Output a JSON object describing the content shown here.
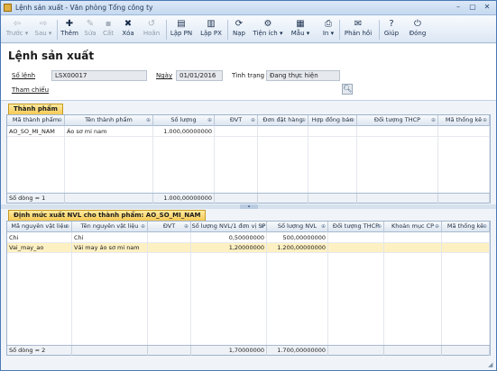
{
  "window": {
    "title": "Lệnh sản xuất - Văn phòng Tổng công ty",
    "controls": [
      "–",
      "▢",
      "✕"
    ]
  },
  "toolbar": [
    {
      "label": "Trước",
      "glyph": "⇦",
      "icon": "back-arrow-icon",
      "enabled": false,
      "dropdown": true
    },
    {
      "label": "Sau",
      "glyph": "⇨",
      "icon": "forward-arrow-icon",
      "enabled": false,
      "dropdown": true
    },
    {
      "label": "Thêm",
      "glyph": "✚",
      "icon": "add-icon",
      "enabled": true
    },
    {
      "label": "Sửa",
      "glyph": "✎",
      "icon": "edit-icon",
      "enabled": false
    },
    {
      "label": "Cất",
      "glyph": "▪",
      "icon": "save-icon",
      "enabled": false
    },
    {
      "label": "Xóa",
      "glyph": "✖",
      "icon": "delete-icon",
      "enabled": true
    },
    {
      "label": "Hoãn",
      "glyph": "↺",
      "icon": "undo-icon",
      "enabled": false
    },
    {
      "label": "Lập PN",
      "glyph": "▤",
      "icon": "receipt-icon",
      "enabled": true
    },
    {
      "label": "Lập PX",
      "glyph": "▥",
      "icon": "issue-icon",
      "enabled": true
    },
    {
      "label": "Nạp",
      "glyph": "⟳",
      "icon": "refresh-icon",
      "enabled": true
    },
    {
      "label": "Tiện ích",
      "glyph": "⚙",
      "icon": "utility-icon",
      "enabled": true,
      "dropdown": true
    },
    {
      "label": "Mẫu",
      "glyph": "▦",
      "icon": "template-icon",
      "enabled": true,
      "dropdown": true
    },
    {
      "label": "In",
      "glyph": "⎙",
      "icon": "print-icon",
      "enabled": true,
      "dropdown": true
    },
    {
      "label": "Phản hồi",
      "glyph": "✉",
      "icon": "feedback-icon",
      "enabled": true
    },
    {
      "label": "Giúp",
      "glyph": "?",
      "icon": "help-icon",
      "enabled": true
    },
    {
      "label": "Đóng",
      "glyph": "⏻",
      "icon": "close-icon",
      "enabled": true
    }
  ],
  "form": {
    "title": "Lệnh sản xuất",
    "so_lenh_label": "Số lệnh",
    "so_lenh": "LSX00017",
    "ngay_label": "Ngày",
    "ngay": "01/01/2016",
    "tinh_trang_label": "Tình trạng",
    "tinh_trang": "Đang thực hiện",
    "tham_chieu_label": "Tham chiếu"
  },
  "products": {
    "tab": "Thành phẩm",
    "columns": [
      "Mã thành phẩm",
      "Tên thành phẩm",
      "Số lượng",
      "ĐVT",
      "Đơn đặt hàng",
      "Hợp đồng bán",
      "Đối tượng THCP",
      "Mã thống kê"
    ],
    "rows": [
      [
        "AO_SO_MI_NAM",
        "Áo sơ mi nam",
        "1.000,00000000",
        "",
        "",
        "",
        "",
        ""
      ]
    ],
    "footer_count": "Số dòng = 1",
    "footer_total": "1.000,00000000"
  },
  "materials": {
    "tab": "Định mức xuất NVL cho thành phẩm: AO_SO_MI_NAM",
    "columns": [
      "Mã nguyên vật liệu",
      "Tên nguyên vật liệu",
      "ĐVT",
      "Số lượng NVL/1 đơn vị SP",
      "Số lượng NVL",
      "Đối tượng THCP",
      "Khoản mục CP",
      "Mã thống kê"
    ],
    "rows": [
      [
        "Chi",
        "Chỉ",
        "",
        "0,50000000",
        "500,00000000",
        "",
        "",
        ""
      ],
      [
        "Vai_may_ao",
        "Vải may áo sơ mi nam",
        "",
        "1,20000000",
        "1.200,00000000",
        "",
        "",
        ""
      ]
    ],
    "selected_row": 1,
    "footer_count": "Số dòng = 2",
    "footer_total_per_unit": "1,70000000",
    "footer_total": "1.700,00000000"
  },
  "colors": {
    "accent": "#f6c955",
    "selected_row": "#fdf0c2",
    "header_border": "#4a79b5"
  }
}
